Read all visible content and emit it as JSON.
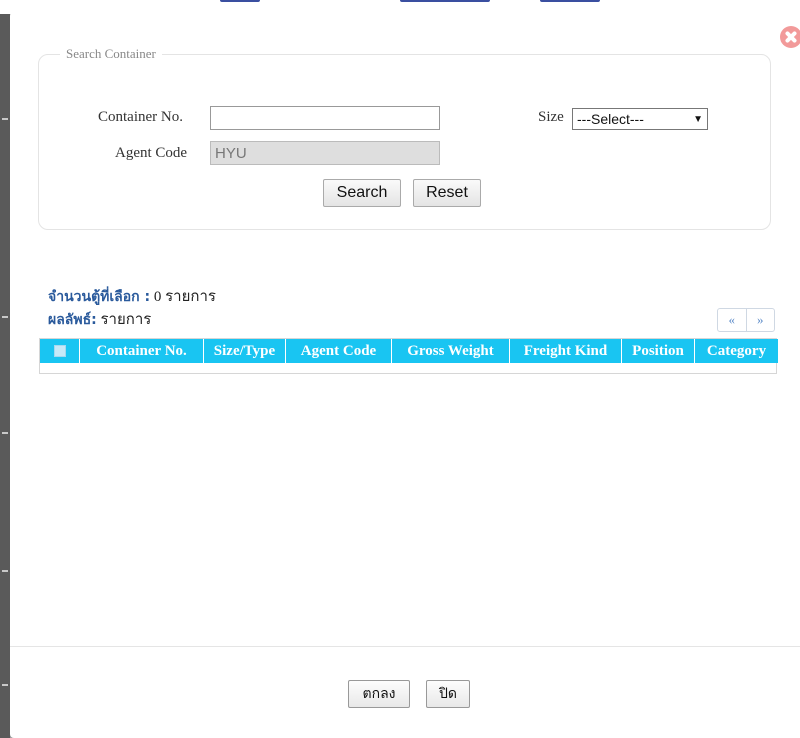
{
  "dialog": {
    "legend": "Search Container"
  },
  "form": {
    "container_no_label": "Container No.",
    "container_no_value": "",
    "size_label": "Size",
    "size_selected": "---Select---",
    "agent_code_label": "Agent Code",
    "agent_code_value": "HYU",
    "search_label": "Search",
    "reset_label": "Reset"
  },
  "summary": {
    "selected_label": "จำนวนตู้ที่เลือก :",
    "selected_value": "0 รายการ",
    "result_label": "ผลลัพธ์:",
    "result_value": "รายการ"
  },
  "pager": {
    "prev": "«",
    "next": "»"
  },
  "table": {
    "columns": [
      "Container No.",
      "Size/Type",
      "Agent Code",
      "Gross Weight",
      "Freight Kind",
      "Position",
      "Category"
    ]
  },
  "footer": {
    "ok_label": "ตกลง",
    "close_label": "ปิด"
  },
  "colors": {
    "header_bg": "#19c5f2",
    "close_icon": "#f29a9a",
    "label_blue": "#2a5a9c"
  }
}
